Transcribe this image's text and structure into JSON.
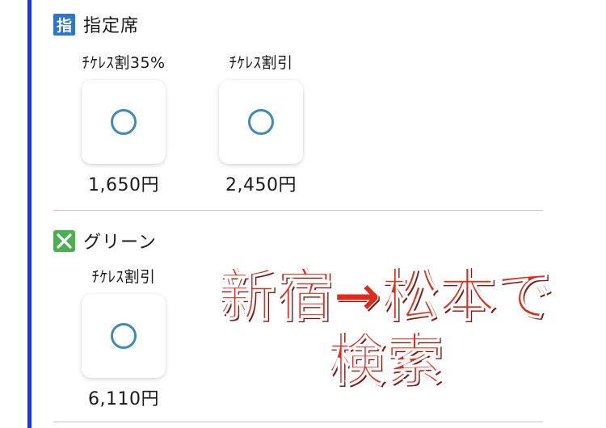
{
  "sections": [
    {
      "badge_text": "指",
      "badge_icon": "reserved-seat-icon",
      "title": "指定席",
      "options": [
        {
          "label": "ﾁｹﾚｽ割35%",
          "price": "1,650円"
        },
        {
          "label": "ﾁｹﾚｽ割引",
          "price": "2,450円"
        }
      ]
    },
    {
      "badge_icon": "green-car-clover-icon",
      "title": "グリーン",
      "options": [
        {
          "label": "ﾁｹﾚｽ割引",
          "price": "6,110円"
        }
      ]
    }
  ],
  "overlay": {
    "line1": "新宿→松本で",
    "line2": "検索"
  },
  "colors": {
    "left_rule": "#1f36d6",
    "badge_blue": "#2f76c4",
    "badge_green": "#4caf50",
    "circle": "#3f8ab8",
    "overlay_text": "#e02a1c"
  }
}
